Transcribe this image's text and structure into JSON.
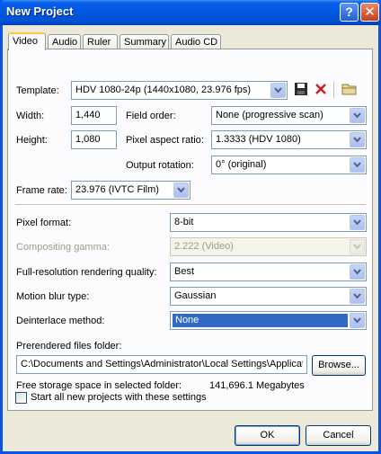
{
  "window": {
    "title": "New Project"
  },
  "tabs": [
    "Video",
    "Audio",
    "Ruler",
    "Summary",
    "Audio CD"
  ],
  "template": {
    "label": "Template:",
    "value": "HDV 1080-24p (1440x1080, 23.976 fps)"
  },
  "width": {
    "label": "Width:",
    "value": "1,440"
  },
  "height": {
    "label": "Height:",
    "value": "1,080"
  },
  "field_order": {
    "label": "Field order:",
    "value": "None (progressive scan)"
  },
  "pixel_aspect": {
    "label": "Pixel aspect ratio:",
    "value": "1.3333 (HDV 1080)"
  },
  "output_rotation": {
    "label": "Output rotation:",
    "value": "0° (original)"
  },
  "frame_rate": {
    "label": "Frame rate:",
    "value": "23.976 (IVTC Film)"
  },
  "pixel_format": {
    "label": "Pixel format:",
    "value": "8-bit"
  },
  "compositing_gamma": {
    "label": "Compositing gamma:",
    "value": "2.222 (Video)"
  },
  "render_quality": {
    "label": "Full-resolution rendering quality:",
    "value": "Best"
  },
  "motion_blur": {
    "label": "Motion blur type:",
    "value": "Gaussian"
  },
  "deinterlace": {
    "label": "Deinterlace method:",
    "value": "None"
  },
  "prerendered": {
    "label": "Prerendered files folder:",
    "path": "C:\\Documents and Settings\\Administrator\\Local Settings\\Application Data\\Sony\\Vegas Pro\\",
    "browse": "Browse..."
  },
  "storage": {
    "label": "Free storage space in selected folder:",
    "value": "141,696.1 Megabytes"
  },
  "start_all": {
    "label": "Start all new projects with these settings",
    "checked": false
  },
  "buttons": {
    "ok": "OK",
    "cancel": "Cancel"
  }
}
